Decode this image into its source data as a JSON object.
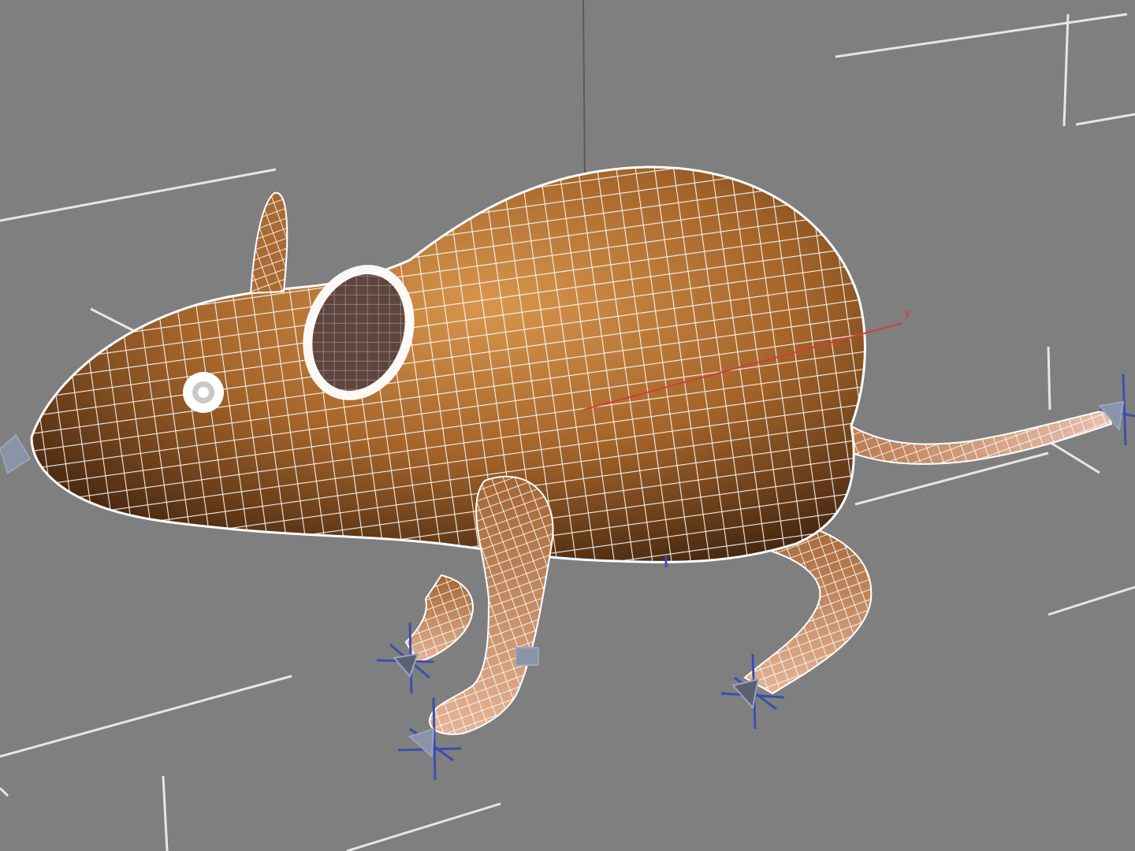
{
  "viewport": {
    "background": "#7f7f7f",
    "grid_color": "#e6e6e6",
    "wire_color": "#ffffff",
    "model_color_light": "#c98a45",
    "model_color_dark": "#3a1f0c",
    "ear_inner_color": "#5e463f",
    "bone_color": "#3b4fb0",
    "gizmo_color": "#8a93a8"
  },
  "axes": {
    "y_label": "y",
    "y_color": "#d23c3c"
  },
  "model": {
    "icon": "mouse-wireframe-model"
  }
}
